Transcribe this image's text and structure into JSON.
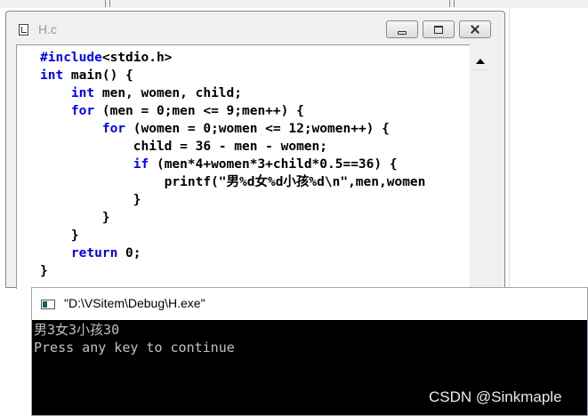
{
  "editor": {
    "title": "H.c",
    "code_lines": [
      [
        {
          "t": "#include",
          "k": true
        },
        {
          "t": "<stdio.h>"
        }
      ],
      [
        {
          "t": "int",
          "k": true
        },
        {
          "t": " main() {"
        }
      ],
      [
        {
          "t": "    "
        },
        {
          "t": "int",
          "k": true
        },
        {
          "t": " men, women, child;"
        }
      ],
      [
        {
          "t": "    "
        },
        {
          "t": "for",
          "k": true
        },
        {
          "t": " (men = 0;men <= 9;men++) {"
        }
      ],
      [
        {
          "t": "        "
        },
        {
          "t": "for",
          "k": true
        },
        {
          "t": " (women = 0;women <= 12;women++) {"
        }
      ],
      [
        {
          "t": "            child = 36 - men - women;"
        }
      ],
      [
        {
          "t": "            "
        },
        {
          "t": "if",
          "k": true
        },
        {
          "t": " (men*4+women*3+child*0.5==36) {"
        }
      ],
      [
        {
          "t": "                printf(\"男%d女%d小孩%d\\n\",men,women"
        }
      ],
      [
        {
          "t": "            }"
        }
      ],
      [
        {
          "t": "        }"
        }
      ],
      [
        {
          "t": "    }"
        }
      ],
      [
        {
          "t": "    "
        },
        {
          "t": "return",
          "k": true
        },
        {
          "t": " 0;"
        }
      ],
      [
        {
          "t": "}"
        }
      ]
    ]
  },
  "console": {
    "title": "\"D:\\VSitem\\Debug\\H.exe\"",
    "lines": [
      "男3女3小孩30",
      "Press any key to continue"
    ]
  },
  "watermark": "CSDN @Sinkmaple",
  "colors": {
    "keyword": "#0000ff",
    "console_bg": "#000000",
    "console_text": "#c0c0c0"
  }
}
